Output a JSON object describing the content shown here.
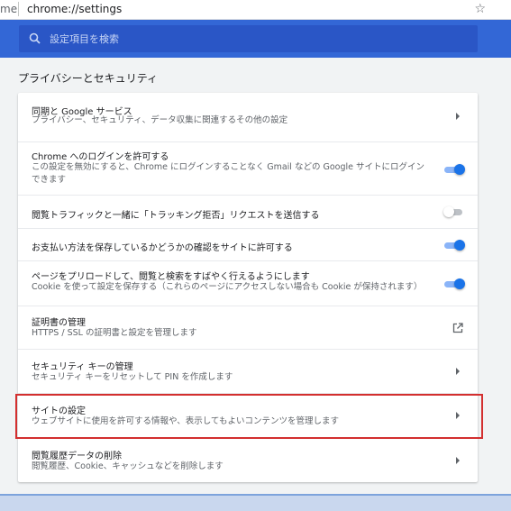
{
  "addressbar": {
    "prefix": "me",
    "url": "chrome://settings",
    "star_icon": "star-icon"
  },
  "header": {
    "color": "#3367d6",
    "search": {
      "placeholder": "設定項目を検索",
      "icon": "search-icon"
    }
  },
  "section": {
    "title": "プライバシーとセキュリティ",
    "rows": [
      {
        "title": "同期と Google サービス",
        "subtitle": "プライバシー、セキュリティ、データ収集に関連するその他の設定",
        "control": "arrow"
      },
      {
        "title": "Chrome へのログインを許可する",
        "subtitle_lines": [
          "この設定を無効にすると、Chrome にログインすることなく Gmail などの Google サイトにログイン",
          "できます"
        ],
        "control": "toggle",
        "enabled": true
      },
      {
        "title": "閲覧トラフィックと一緒に「トラッキング拒否」リクエストを送信する",
        "control": "toggle",
        "enabled": false
      },
      {
        "title": "お支払い方法を保存しているかどうかの確認をサイトに許可する",
        "control": "toggle",
        "enabled": true
      },
      {
        "title": "ページをプリロードして、閲覧と検索をすばやく行えるようにします",
        "subtitle": "Cookie を使って設定を保存する（これらのページにアクセスしない場合も Cookie が保持されます）",
        "control": "toggle",
        "enabled": true
      },
      {
        "title": "証明書の管理",
        "subtitle": "HTTPS / SSL の証明書と設定を管理します",
        "control": "external-link"
      },
      {
        "title": "セキュリティ キーの管理",
        "subtitle": "セキュリティ キーをリセットして PIN を作成します",
        "control": "arrow"
      },
      {
        "title": "サイトの設定",
        "subtitle": "ウェブサイトに使用を許可する情報や、表示してもよいコンテンツを管理します",
        "control": "arrow",
        "highlighted": true
      },
      {
        "title": "閲覧履歴データの削除",
        "subtitle": "閲覧履歴、Cookie、キャッシュなどを削除します",
        "control": "arrow"
      }
    ]
  },
  "colors": {
    "accent": "#1a73e8",
    "highlight_border": "#d32f2f"
  }
}
